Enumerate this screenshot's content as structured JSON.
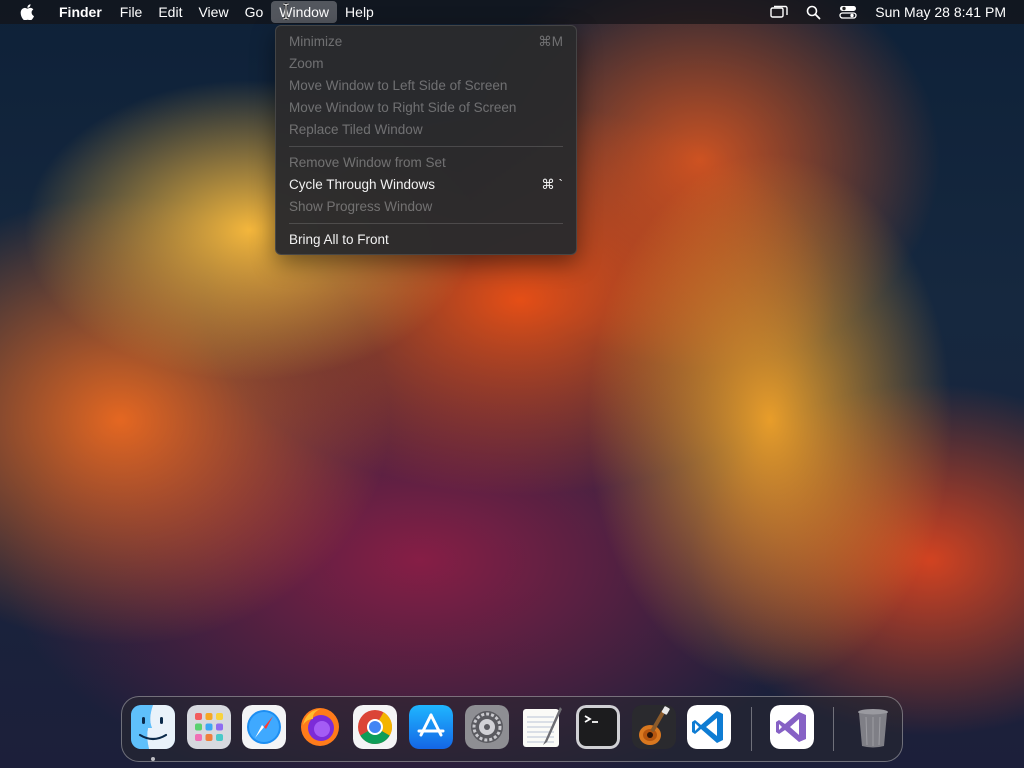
{
  "menubar": {
    "apple_icon": "apple-icon",
    "items": [
      {
        "label": "Finder"
      },
      {
        "label": "File"
      },
      {
        "label": "Edit"
      },
      {
        "label": "View"
      },
      {
        "label": "Go"
      },
      {
        "label": "Window"
      },
      {
        "label": "Help"
      }
    ],
    "status_icons": [
      "screen-mirroring-icon",
      "spotlight-search-icon",
      "control-center-icon"
    ],
    "clock": "Sun May 28  8:41 PM"
  },
  "window_menu": {
    "items": [
      {
        "label": "Minimize",
        "shortcut": "⌘M",
        "enabled": false
      },
      {
        "label": "Zoom",
        "shortcut": "",
        "enabled": false
      },
      {
        "label": "Move Window to Left Side of Screen",
        "shortcut": "",
        "enabled": false
      },
      {
        "label": "Move Window to Right Side of Screen",
        "shortcut": "",
        "enabled": false
      },
      {
        "label": "Replace Tiled Window",
        "shortcut": "",
        "enabled": false
      },
      {
        "label": "Remove Window from Set",
        "shortcut": "",
        "enabled": false
      },
      {
        "label": "Cycle Through Windows",
        "shortcut": "⌘ `",
        "enabled": true
      },
      {
        "label": "Show Progress Window",
        "shortcut": "",
        "enabled": false
      },
      {
        "label": "Bring All to Front",
        "shortcut": "",
        "enabled": true
      }
    ]
  },
  "dock": {
    "apps": [
      {
        "name": "Finder",
        "icon": "finder-icon",
        "running": true
      },
      {
        "name": "Launchpad",
        "icon": "launchpad-icon",
        "running": false
      },
      {
        "name": "Safari",
        "icon": "safari-icon",
        "running": false
      },
      {
        "name": "Firefox",
        "icon": "firefox-icon",
        "running": false
      },
      {
        "name": "Google Chrome",
        "icon": "chrome-icon",
        "running": false
      },
      {
        "name": "App Store",
        "icon": "app-store-icon",
        "running": false
      },
      {
        "name": "System Settings",
        "icon": "system-settings-icon",
        "running": false
      },
      {
        "name": "TextEdit",
        "icon": "textedit-icon",
        "running": false
      },
      {
        "name": "Terminal",
        "icon": "terminal-icon",
        "running": false
      },
      {
        "name": "GarageBand",
        "icon": "garageband-icon",
        "running": false
      },
      {
        "name": "Visual Studio Code",
        "icon": "vscode-icon",
        "running": false
      },
      {
        "name": "Visual Studio",
        "icon": "visual-studio-icon",
        "running": false
      },
      {
        "name": "Trash",
        "icon": "trash-icon",
        "running": false
      }
    ]
  }
}
